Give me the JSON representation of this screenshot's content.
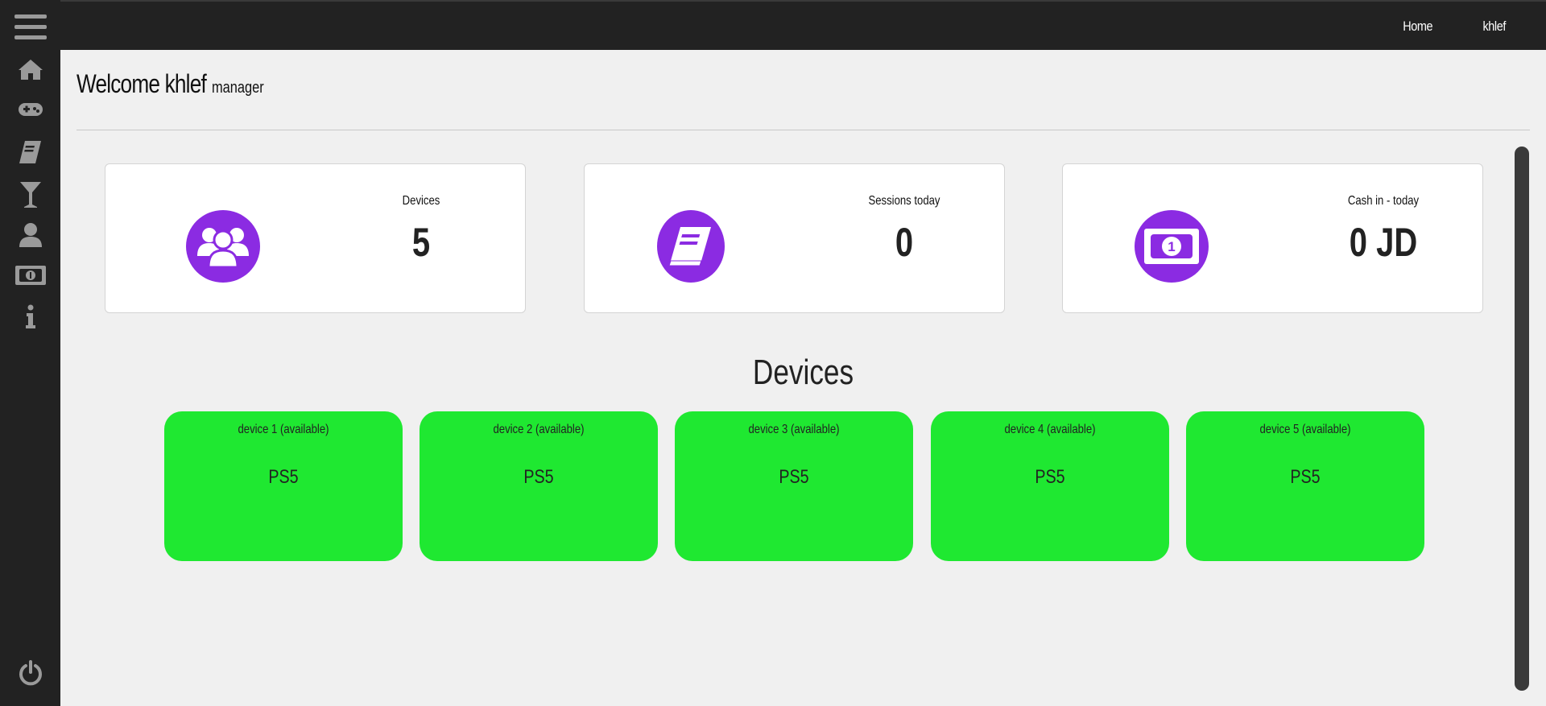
{
  "topnav": {
    "home": "Home",
    "user": "khlef"
  },
  "sidebar": {
    "items": [
      {
        "icon": "menu-icon"
      },
      {
        "icon": "home-icon"
      },
      {
        "icon": "gamepad-icon"
      },
      {
        "icon": "book-icon"
      },
      {
        "icon": "cocktail-icon"
      },
      {
        "icon": "user-icon"
      },
      {
        "icon": "money-bill-icon"
      },
      {
        "icon": "info-icon"
      }
    ],
    "bottom_icon": "power-icon"
  },
  "header": {
    "welcome": "Welcome khlef",
    "role": "manager"
  },
  "stats": [
    {
      "label": "Devices",
      "value": "5",
      "icon": "users-icon"
    },
    {
      "label": "Sessions today",
      "value": "0",
      "icon": "book-icon"
    },
    {
      "label": "Cash in - today",
      "value": "0 JD",
      "icon": "money-bill-icon"
    }
  ],
  "devices_section": {
    "title": "Devices",
    "items": [
      {
        "name": "device 1 (available)",
        "type": "PS5"
      },
      {
        "name": "device 2 (available)",
        "type": "PS5"
      },
      {
        "name": "device 3 (available)",
        "type": "PS5"
      },
      {
        "name": "device 4 (available)",
        "type": "PS5"
      },
      {
        "name": "device 5 (available)",
        "type": "PS5"
      }
    ]
  },
  "colors": {
    "sidebar": "#222222",
    "accent": "#8b2be2",
    "available": "#1fe831",
    "background": "#f0f0f0"
  }
}
